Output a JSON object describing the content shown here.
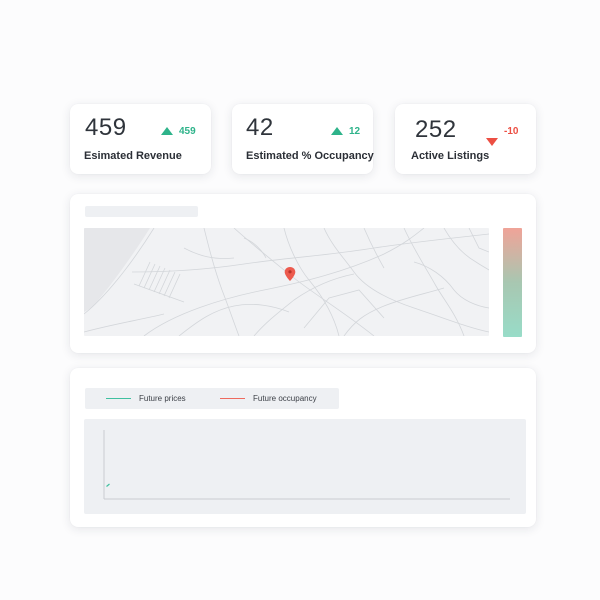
{
  "kpis": [
    {
      "value": "459",
      "delta": "459",
      "direction": "up",
      "label": "Esimated Revenue"
    },
    {
      "value": "42",
      "delta": "12",
      "direction": "up",
      "label": "Estimated % Occupancy"
    },
    {
      "value": "252",
      "delta": "-10",
      "direction": "down",
      "label": "Active Listings"
    }
  ],
  "map": {
    "pin_icon": "map-pin-icon",
    "scale_gradient": [
      "#f0a398",
      "#a8c7b1",
      "#98dcc8"
    ]
  },
  "chart": {
    "legend": [
      {
        "name": "Future prices",
        "color": "#3fc0a0"
      },
      {
        "name": "Future occupancy",
        "color": "#ee6a5e"
      }
    ]
  },
  "colors": {
    "up": "#2eb38a",
    "down": "#ec4f43"
  }
}
